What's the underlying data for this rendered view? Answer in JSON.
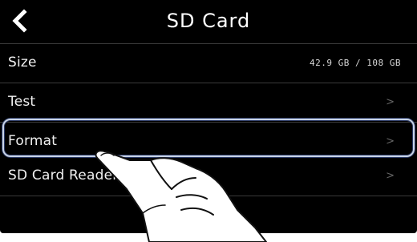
{
  "header": {
    "title": "SD Card",
    "back_icon": "chevron-left-icon"
  },
  "rows": [
    {
      "label": "Size",
      "value": "42.9 GB /  108 GB"
    },
    {
      "label": "Test",
      "chevron": ">"
    },
    {
      "label": "Format",
      "chevron": ">"
    },
    {
      "label": "SD Card Reader",
      "chevron": ">"
    }
  ],
  "highlight": {
    "target": "Format",
    "color": "#c8d3e6"
  },
  "pointer": {
    "icon": "pointing-hand-icon"
  }
}
